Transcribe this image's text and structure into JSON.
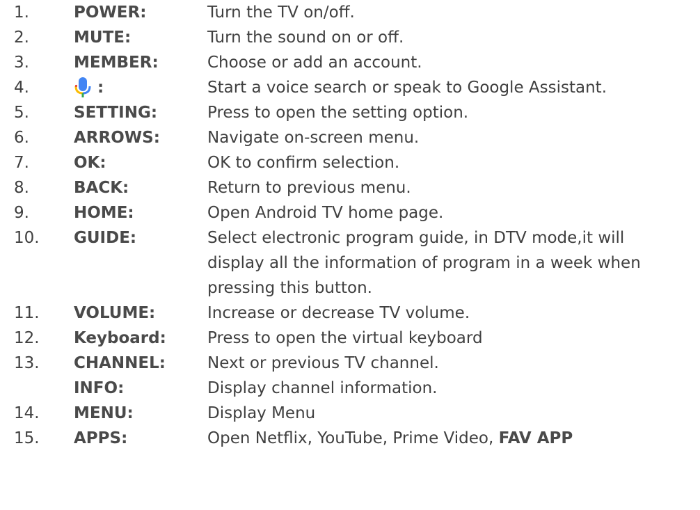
{
  "colors": {
    "mic_blue": "#4285F4",
    "mic_yellow": "#FBBC05",
    "mic_green": "#34A853",
    "mic_red": "#EA4335"
  },
  "items": [
    {
      "num": "1.",
      "label": "POWER:",
      "desc": [
        "Turn the TV on/off."
      ]
    },
    {
      "num": "2.",
      "label": "MUTE:",
      "desc": [
        "Turn the sound on or off."
      ]
    },
    {
      "num": "3.",
      "label": "MEMBER:",
      "desc": [
        "Choose or add an account."
      ]
    },
    {
      "num": "4.",
      "label": ":",
      "icon": "google-mic-icon",
      "desc": [
        "Start a voice search or speak to Google Assistant."
      ]
    },
    {
      "num": "5.",
      "label": "SETTING:",
      "desc": [
        "Press to open the setting option."
      ]
    },
    {
      "num": "6.",
      "label": "ARROWS:",
      "desc": [
        "Navigate on-screen menu."
      ]
    },
    {
      "num": "7.",
      "label": "OK:",
      "desc": [
        "OK to confirm selection."
      ]
    },
    {
      "num": "8.",
      "label": "BACK:",
      "desc": [
        "Return to previous menu."
      ]
    },
    {
      "num": "9.",
      "label": "HOME:",
      "desc": [
        "Open Android TV home page."
      ]
    },
    {
      "num": "10.",
      "label": "GUIDE:",
      "desc": [
        "Select electronic program guide, in DTV mode,it will",
        "display all the information of program in a week when",
        "pressing this button."
      ]
    },
    {
      "num": "11.",
      "label": "VOLUME:",
      "desc": [
        "Increase or decrease TV volume."
      ]
    },
    {
      "num": "12.",
      "label": "Keyboard:",
      "desc": [
        "Press to open the virtual keyboard"
      ]
    },
    {
      "num": "13.",
      "label": "CHANNEL:",
      "desc": [
        "Next or previous TV channel."
      ]
    },
    {
      "num": "",
      "label": "INFO:",
      "desc": [
        "Display channel information."
      ]
    },
    {
      "num": "14.",
      "label": "MENU:",
      "desc": [
        "Display Menu"
      ]
    },
    {
      "num": "15.",
      "label": "APPS:",
      "desc_plain": "Open Netflix, YouTube, Prime Video, ",
      "desc_bold": "FAV APP"
    }
  ]
}
